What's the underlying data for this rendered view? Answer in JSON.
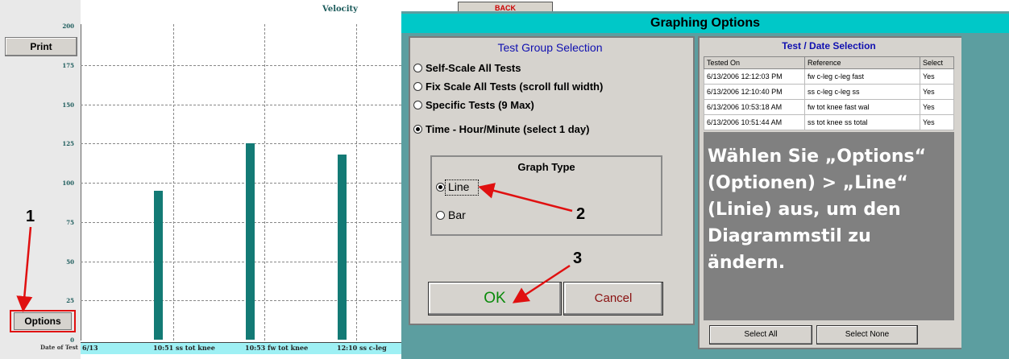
{
  "chart": {
    "title": "Velocity",
    "back_label": "BACK",
    "print_label": "Print",
    "options_label": "Options",
    "y_ticks": [
      "200",
      "175",
      "150",
      "125",
      "100",
      "75",
      "50",
      "25",
      "0"
    ],
    "x_axis_label": "Date of Test",
    "x_labels": [
      "6/13",
      "10:51  ss tot knee",
      "10:53  fw tot knee",
      "12:10  ss c-leg"
    ],
    "bar_color": "#137a75"
  },
  "chart_data": {
    "type": "bar",
    "categories": [
      "10:51  ss tot knee",
      "10:53  fw tot knee",
      "12:10  ss c-leg"
    ],
    "values": [
      95,
      125,
      118
    ],
    "title": "Velocity",
    "xlabel": "Date of Test",
    "ylabel": "",
    "ylim": [
      0,
      200
    ]
  },
  "annotations": {
    "step1": "1",
    "step2": "2",
    "step3": "3",
    "arrow_color": "#e01010"
  },
  "dialog": {
    "title": "Graphing Options",
    "test_group": {
      "header": "Test Group Selection",
      "options": [
        {
          "label": "Self-Scale All Tests",
          "selected": false
        },
        {
          "label": "Fix Scale All Tests (scroll full width)",
          "selected": false
        },
        {
          "label": "Specific Tests (9 Max)",
          "selected": false
        },
        {
          "label": "Time - Hour/Minute (select 1 day)",
          "selected": true
        }
      ]
    },
    "graph_type": {
      "header": "Graph Type",
      "options": [
        {
          "label": "Line",
          "selected": true
        },
        {
          "label": "Bar",
          "selected": false
        }
      ]
    },
    "ok_label": "OK",
    "cancel_label": "Cancel",
    "test_date": {
      "header": "Test / Date Selection",
      "columns": [
        "Tested On",
        "Reference",
        "Select"
      ],
      "rows": [
        [
          "6/13/2006 12:12:03 PM",
          "fw c-leg c-leg fast",
          "Yes"
        ],
        [
          "6/13/2006 12:10:40 PM",
          "ss c-leg c-leg ss",
          "Yes"
        ],
        [
          "6/13/2006 10:53:18 AM",
          "fw tot knee fast wal",
          "Yes"
        ],
        [
          "6/13/2006 10:51:44 AM",
          "ss tot knee ss total",
          "Yes"
        ]
      ],
      "select_all_label": "Select All",
      "select_none_label": "Select None"
    },
    "overlay_text": "Wählen Sie „Options“ (Optionen) > „Line“ (Linie) aus, um den Diagrammstil zu ändern."
  }
}
